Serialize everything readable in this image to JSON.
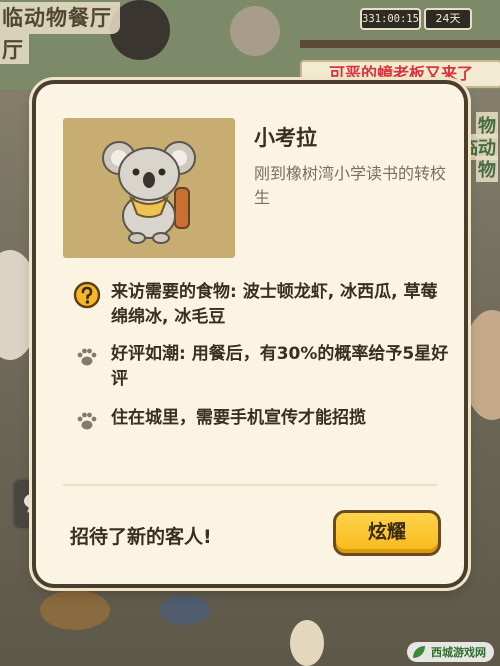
{
  "hud": {
    "restaurant_title_line1": "临动物餐厅",
    "restaurant_title_line2": "厅",
    "scrolling_text": "欢迎光临动物餐厅",
    "timer": "331:00:15",
    "days": "24天",
    "event_banner": "可恶的蟑老板又来了",
    "side_text_1": "物",
    "side_text_2": "临动",
    "side_text_3": "物"
  },
  "dialog": {
    "visitor_name": "小考拉",
    "visitor_description": "刚到橡树湾小学读书的转校生",
    "info": [
      {
        "icon": "question-icon",
        "text": "来访需要的食物: 波士顿龙虾, 冰西瓜, 草莓绵绵冰, 冰毛豆"
      },
      {
        "icon": "paw-icon",
        "text": "好评如潮: 用餐后，有30%的概率给予5星好评"
      },
      {
        "icon": "paw-icon",
        "text": "住在城里，需要手机宣传才能招揽"
      }
    ],
    "footer_message": "招待了新的客人!",
    "show_off_button": "炫耀"
  },
  "watermark": {
    "text": "西城游戏网"
  },
  "colors": {
    "dialog_bg": "#fbf4e3",
    "portrait_bg": "#c7ad71",
    "button_yellow": "#f7b91b",
    "banner_red": "#d8353e",
    "question_icon_yellow": "#f5b729"
  }
}
